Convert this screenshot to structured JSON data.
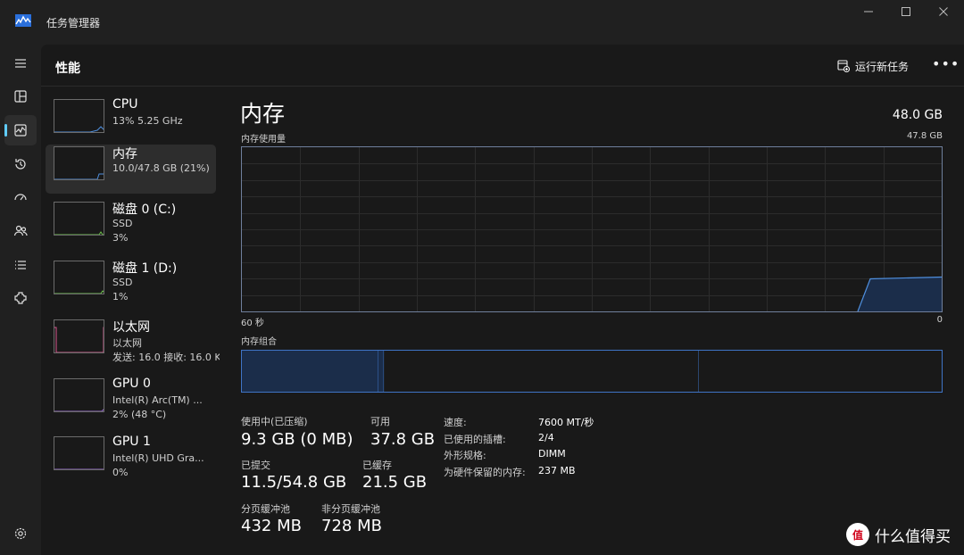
{
  "window": {
    "title": "任务管理器"
  },
  "header": {
    "title": "性能",
    "run_task": "运行新任务",
    "more": "•••"
  },
  "nav": [
    "menu-icon",
    "processes-icon",
    "performance-icon",
    "app-history-icon",
    "startup-icon",
    "users-icon",
    "details-icon",
    "services-icon",
    "settings-icon"
  ],
  "devices": [
    {
      "name": "CPU",
      "l1": "13%  5.25 GHz",
      "l2": "",
      "color": "#4f8fde"
    },
    {
      "name": "内存",
      "l1": "10.0/47.8 GB (21%)",
      "l2": "",
      "color": "#4f8fde"
    },
    {
      "name": "磁盘 0 (C:)",
      "l1": "SSD",
      "l2": "3%",
      "color": "#6cc24a"
    },
    {
      "name": "磁盘 1 (D:)",
      "l1": "SSD",
      "l2": "1%",
      "color": "#6cc24a"
    },
    {
      "name": "以太网",
      "l1": "以太网",
      "l2": "发送: 16.0  接收: 16.0 K",
      "color": "#d9578f"
    },
    {
      "name": "GPU 0",
      "l1": "Intel(R) Arc(TM) ...",
      "l2": "2% (48 °C)",
      "color": "#9c6ad6"
    },
    {
      "name": "GPU 1",
      "l1": "Intel(R) UHD Gra...",
      "l2": "0%",
      "color": "#9c6ad6"
    }
  ],
  "detail": {
    "title": "内存",
    "total": "48.0 GB",
    "usage_label": "内存使用量",
    "usage_max": "47.8 GB",
    "time_left": "60 秒",
    "time_right": "0",
    "composition_label": "内存组合",
    "composition": {
      "in_use": 9.3,
      "modified": 0.4,
      "standby": 21.5,
      "free": 16.6
    }
  },
  "stats": {
    "in_use_label": "使用中(已压缩)",
    "in_use_value": "9.3 GB (0 MB)",
    "available_label": "可用",
    "available_value": "37.8 GB",
    "committed_label": "已提交",
    "committed_value": "11.5/54.8 GB",
    "cached_label": "已缓存",
    "cached_value": "21.5 GB",
    "paged_label": "分页缓冲池",
    "paged_value": "432 MB",
    "nonpaged_label": "非分页缓冲池",
    "nonpaged_value": "728 MB"
  },
  "specs": [
    {
      "key": "速度:",
      "value": "7600 MT/秒"
    },
    {
      "key": "已使用的插槽:",
      "value": "2/4"
    },
    {
      "key": "外形规格:",
      "value": "DIMM"
    },
    {
      "key": "为硬件保留的内存:",
      "value": "237 MB"
    }
  ],
  "watermark": {
    "logo": "值",
    "text": "什么值得买"
  },
  "colors": {
    "accent": "#60cdff",
    "memory_line": "#4f8fde",
    "memory_fill": "#1b2d4a",
    "grid": "#2c2c2c"
  }
}
